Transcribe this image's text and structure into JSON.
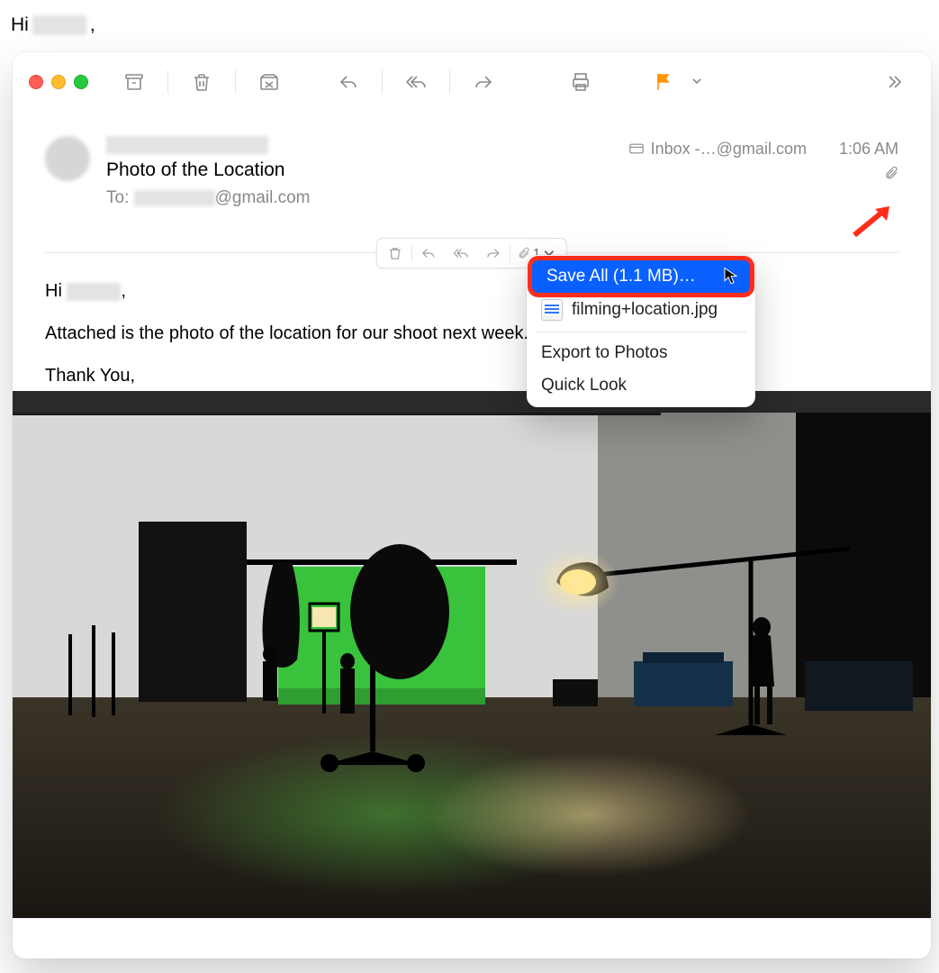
{
  "bg_message": {
    "greeting_prefix": "Hi ",
    "greeting_suffix": ","
  },
  "toolbar": {
    "icons": [
      "archive",
      "trash",
      "junk",
      "reply",
      "reply-all",
      "forward",
      "print",
      "flag",
      "flag-dropdown",
      "overflow"
    ]
  },
  "header": {
    "subject": "Photo of the Location",
    "to_prefix": "To:  ",
    "to_domain": "@gmail.com",
    "inbox_label": "Inbox -…@gmail.com",
    "time": "1:06 AM"
  },
  "mini_toolbar": {
    "attach_count": "1"
  },
  "body": {
    "greeting_prefix": "Hi ",
    "greeting_suffix": ",",
    "line1": "Attached is the photo of the location for our shoot next week.",
    "thanks": "Thank You,"
  },
  "dropdown": {
    "save_all": "Save All (1.1 MB)…",
    "file_name": "filming+location.jpg",
    "export": "Export to Photos",
    "quick_look": "Quick Look"
  }
}
